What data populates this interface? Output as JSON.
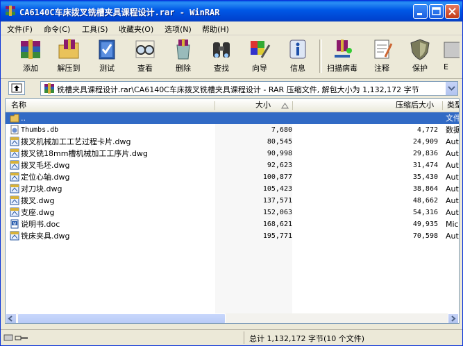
{
  "window": {
    "title": "CA6140C车床拨叉铣槽夹具课程设计.rar - WinRAR"
  },
  "menu": [
    {
      "label": "文件(F)"
    },
    {
      "label": "命令(C)"
    },
    {
      "label": "工具(S)"
    },
    {
      "label": "收藏夹(O)"
    },
    {
      "label": "选项(N)"
    },
    {
      "label": "帮助(H)"
    }
  ],
  "toolbar": [
    {
      "label": "添加",
      "icon": "add-books-icon"
    },
    {
      "label": "解压到",
      "icon": "extract-folder-icon"
    },
    {
      "label": "测试",
      "icon": "test-book-icon"
    },
    {
      "label": "查看",
      "icon": "view-glasses-icon"
    },
    {
      "label": "删除",
      "icon": "delete-recycle-icon"
    },
    {
      "label": "查找",
      "icon": "find-binoculars-icon"
    },
    {
      "label": "向导",
      "icon": "wizard-icon"
    },
    {
      "label": "信息",
      "icon": "info-icon"
    },
    {
      "label": "扫描病毒",
      "icon": "virus-scan-icon"
    },
    {
      "label": "注释",
      "icon": "comment-notepad-icon"
    },
    {
      "label": "保护",
      "icon": "protect-shield-icon"
    },
    {
      "label": "E",
      "icon": "sfx-icon"
    }
  ],
  "address": {
    "text": "铣槽夹具课程设计.rar\\CA6140C车床拨叉铣槽夹具课程设计 - RAR 压缩文件, 解包大小为 1,132,172 字节"
  },
  "columns": {
    "name": "名称",
    "size": "大小",
    "packed": "压缩后大小",
    "type": "类型"
  },
  "files": [
    {
      "name": "..",
      "size": "",
      "packed": "",
      "type": "文件",
      "icon": "folder-up-icon",
      "selected": true
    },
    {
      "name": "Thumbs.db",
      "size": "7,680",
      "packed": "4,772",
      "type": "数据",
      "icon": "db-file-icon",
      "mono": true
    },
    {
      "name": "拨叉机械加工工艺过程卡片.dwg",
      "size": "80,545",
      "packed": "24,909",
      "type": "Aut",
      "icon": "dwg-file-icon"
    },
    {
      "name": "拨叉铣18mm槽机械加工工序片.dwg",
      "size": "90,998",
      "packed": "29,836",
      "type": "Aut",
      "icon": "dwg-file-icon"
    },
    {
      "name": "拨叉毛坯.dwg",
      "size": "92,623",
      "packed": "31,474",
      "type": "Aut",
      "icon": "dwg-file-icon"
    },
    {
      "name": "定位心轴.dwg",
      "size": "100,877",
      "packed": "35,430",
      "type": "Aut",
      "icon": "dwg-file-icon"
    },
    {
      "name": "对刀块.dwg",
      "size": "105,423",
      "packed": "38,864",
      "type": "Aut",
      "icon": "dwg-file-icon"
    },
    {
      "name": "拨叉.dwg",
      "size": "137,571",
      "packed": "48,662",
      "type": "Aut",
      "icon": "dwg-file-icon"
    },
    {
      "name": "支座.dwg",
      "size": "152,063",
      "packed": "54,316",
      "type": "Aut",
      "icon": "dwg-file-icon"
    },
    {
      "name": "说明书.doc",
      "size": "168,621",
      "packed": "49,935",
      "type": "Mic",
      "icon": "doc-file-icon"
    },
    {
      "name": "铣床夹具.dwg",
      "size": "195,771",
      "packed": "70,598",
      "type": "Aut",
      "icon": "dwg-file-icon"
    }
  ],
  "status": {
    "text": "总计 1,132,172 字节(10 个文件)"
  },
  "colors": {
    "title_blue": "#0058e6",
    "selection": "#316ac5",
    "chrome": "#ece9d8"
  }
}
